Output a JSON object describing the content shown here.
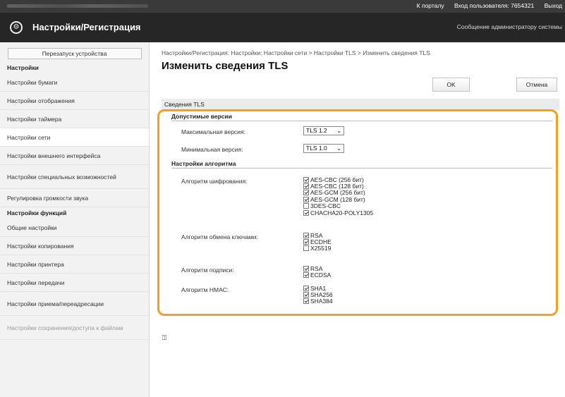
{
  "topbar": {
    "portal": "К порталу",
    "login_user": "Вход пользователя: 7654321",
    "logout": "Выход"
  },
  "header": {
    "title": "Настройки/Регистрация",
    "admin_message": "Сообщение администратору системы"
  },
  "sidebar": {
    "restart_button": "Перезапуск устройства",
    "settings_title": "Настройки",
    "items": [
      {
        "label": "Настройки бумаги"
      },
      {
        "label": "Настройки отображения"
      },
      {
        "label": "Настройки таймера"
      },
      {
        "label": "Настройки сети"
      },
      {
        "label": "Настройки внешнего интерфейса"
      },
      {
        "label": "Настройки специальных возможностей"
      },
      {
        "label": "Регулировка громкости звука"
      }
    ],
    "functions_title": "Настройки функций",
    "func_items": [
      {
        "label": "Общие настройки"
      },
      {
        "label": "Настройки копирования"
      },
      {
        "label": "Настройки принтера"
      },
      {
        "label": "Настройки передачи"
      },
      {
        "label": "Настройки приема/переадресации"
      },
      {
        "label": "Настройки сохранения/доступа к файлам"
      }
    ]
  },
  "main": {
    "breadcrumb": "Настройки/Регистрация: Настройки: Настройки сети > Настройки TLS > Изменить сведения TLS",
    "page_title": "Изменить сведения TLS",
    "ok_button": "OK",
    "cancel_button": "Отмена",
    "section_title": "Сведения TLS",
    "versions_title": "Допустимые версии",
    "max_version_label": "Максимальная версия:",
    "max_version_value": "TLS 1.2",
    "min_version_label": "Минимальная версия:",
    "min_version_value": "TLS 1.0",
    "algo_title": "Настройки алгоритма",
    "cipher_label": "Алгоритм шифрования:",
    "ciphers": [
      {
        "label": "AES-CBC (256 бит)",
        "checked": true
      },
      {
        "label": "AES-CBC (128 бит)",
        "checked": true
      },
      {
        "label": "AES-GCM (256 бит)",
        "checked": true
      },
      {
        "label": "AES-GCM (128 бит)",
        "checked": true
      },
      {
        "label": "3DES-CBC",
        "checked": false
      },
      {
        "label": "CHACHA20-POLY1305",
        "checked": true
      }
    ],
    "kex_label": "Алгоритм обмена ключами:",
    "kex": [
      {
        "label": "RSA",
        "checked": true
      },
      {
        "label": "ECDHE",
        "checked": true
      },
      {
        "label": "X25519",
        "checked": false
      }
    ],
    "sig_label": "Алгоритм подписи:",
    "sig": [
      {
        "label": "RSA",
        "checked": true
      },
      {
        "label": "ECDSA",
        "checked": true
      }
    ],
    "hmac_label": "Алгоритм HMAC:",
    "hmac": [
      {
        "label": "SHA1",
        "checked": true
      },
      {
        "label": "SHA256",
        "checked": true
      },
      {
        "label": "SHA384",
        "checked": true
      }
    ]
  },
  "colors": {
    "highlight": "#f1a020",
    "header_bg": "#262626"
  }
}
